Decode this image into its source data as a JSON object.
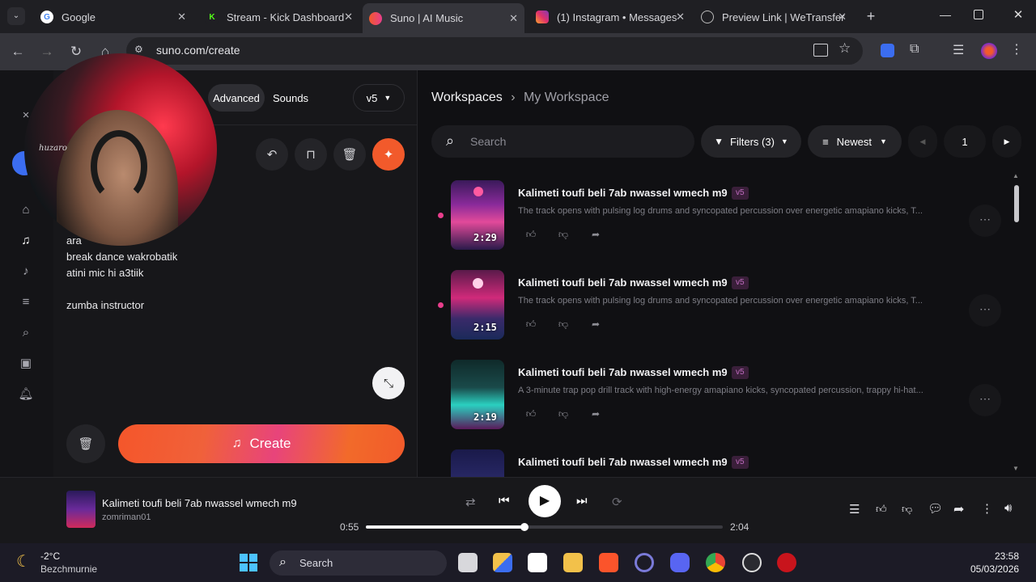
{
  "browser": {
    "tabs": [
      {
        "label": "Google",
        "icon": "google-icon"
      },
      {
        "label": "Stream - Kick Dashboard",
        "icon": "kick-icon"
      },
      {
        "label": "Suno | AI Music",
        "icon": "suno-icon",
        "active": true
      },
      {
        "label": "(1) Instagram • Messages",
        "icon": "instagram-icon"
      },
      {
        "label": "Preview Link | WeTransfer",
        "icon": "globe-icon"
      }
    ],
    "url": "suno.com/create"
  },
  "create_panel": {
    "tabs": [
      "Advanced",
      "Sounds"
    ],
    "model": "v5",
    "lyrics": [
      "ara",
      "break dance wakrobatik",
      "atini mic hi a3tiik",
      "zumba instructor"
    ],
    "create_label": "Create"
  },
  "workspace": {
    "breadcrumb": [
      "Workspaces",
      "My Workspace"
    ],
    "search_placeholder": "Search",
    "filters_label": "Filters (3)",
    "sort_label": "Newest",
    "page": "1",
    "songs": [
      {
        "title": "Kalimeti toufi beli 7ab nwassel wmech m9",
        "version": "v5",
        "duration": "2:29",
        "desc": "The track opens with pulsing log drums and syncopated percussion over energetic amapiano kicks, T...",
        "new": true
      },
      {
        "title": "Kalimeti toufi beli 7ab nwassel wmech m9",
        "version": "v5",
        "duration": "2:15",
        "desc": "The track opens with pulsing log drums and syncopated percussion over energetic amapiano kicks, T...",
        "new": true
      },
      {
        "title": "Kalimeti toufi beli 7ab nwassel wmech m9",
        "version": "v5",
        "duration": "2:19",
        "desc": "A 3-minute trap pop drill track with high-energy amapiano kicks, syncopated percussion, trappy hi-hat...",
        "new": false
      },
      {
        "title": "Kalimeti toufi beli 7ab nwassel wmech m9",
        "version": "v5",
        "duration": "",
        "desc": "",
        "new": false
      }
    ]
  },
  "player": {
    "title": "Kalimeti toufi beli 7ab nwassel wmech m9",
    "artist": "zomriman01",
    "elapsed": "0:55",
    "total": "2:04",
    "progress": 0.445
  },
  "taskbar": {
    "weather_temp": "-2°C",
    "weather_place": "Bezchmurnie",
    "search_label": "Search",
    "time": "23:58",
    "date": "05/03/2026"
  },
  "webcam": {
    "logo_text": "huzaro"
  },
  "colors": {
    "accent": "#f25a2b",
    "pink": "#e83e8c",
    "version_badge": "#c06cc0"
  }
}
